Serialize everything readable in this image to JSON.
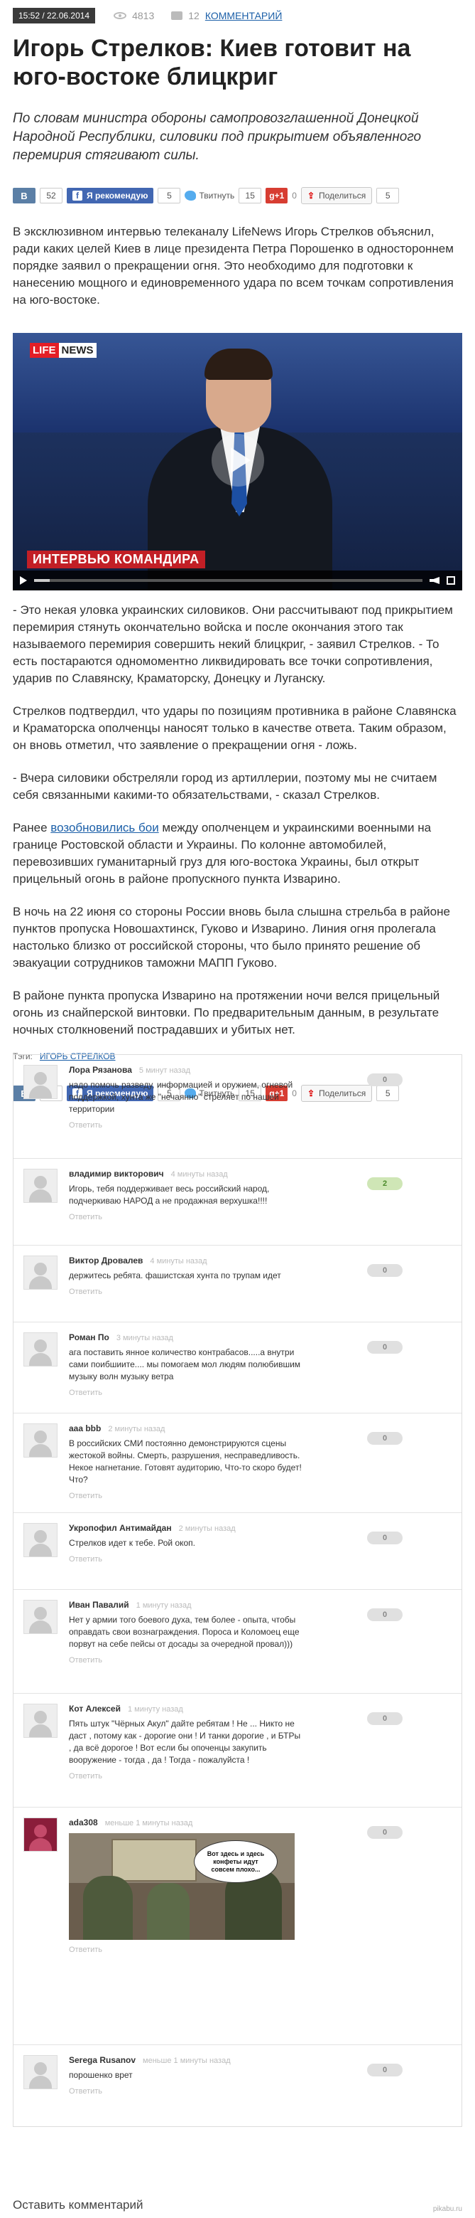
{
  "meta": {
    "date": "15:52 / 22.06.2014",
    "views": "4813",
    "comments_count": "12",
    "comments_link": "комментарий"
  },
  "article": {
    "title": "Игорь Стрелков: Киев готовит на юго-востоке блицкриг",
    "lead": "По словам министра обороны самопровозглашенной Донецкой Народной Республики, силовики под прикрытием объявленного перемирия стягивают силы.",
    "paragraphs": [
      "В эксклюзивном интервью телеканалу LifeNews Игорь Стрелков объяснил, ради каких целей Киев в лице президента Петра Порошенко в одностороннем порядке заявил о прекращении огня. Это необходимо для подготовки к нанесению мощного и единовременного удара по всем точкам сопротивления на юго-востоке.",
      "- Это некая уловка украинских силовиков. Они рассчитывают под прикрытием перемирия стянуть окончательно войска и после окончания этого так называемого перемирия совершить некий блицкриг, - заявил Стрелков. - То есть постараются одномоментно ликвидировать все точки сопротивления, ударив по Славянску, Краматорску, Донецку и Луганску.",
      "Стрелков подтвердил, что удары по позициям противника в районе Славянска и Краматорска ополченцы наносят только в качестве ответа. Таким образом, он вновь отметил, что заявление о прекращении огня - ложь.",
      "- Вчера силовики обстреляли город из артиллерии, поэтому мы не считаем себя связанными какими-то обязательствами, - сказал Стрелков."
    ],
    "p5_before": "Ранее ",
    "p5_link": "возобновились бои",
    "p5_after": " между ополченцем и украинскими военными на границе Ростовской области и Украины. По колонне автомобилей, перевозивших гуманитарный груз для юго-востока Украины, был открыт прицельный огонь в районе пропускного пункта Изварино.",
    "p6": "В ночь на 22 июня со стороны России вновь была слышна стрельба в районе пунктов пропуска Новошахтинск, Гуково и Изварино. Линия огня пролегала настолько близко от российской стороны, что было принято решение об эвакуации сотрудников таможни МАПП Гуково.",
    "p7": "В районе пункта пропуска Изварино на протяжении ночи велся прицельный огонь из снайперской винтовки. По предварительным данным, в результате ночных столкновений пострадавших и убитых нет."
  },
  "share": {
    "vk_label": "В",
    "vk_count": "52",
    "fb_label": "Я рекомендую",
    "fb_count": "5",
    "tw_label": "Твитнуть",
    "tw_count": "15",
    "gp_label": "g+1",
    "gp_count": "0",
    "share_label": "Поделиться",
    "share_count": "5"
  },
  "share_bottom": {
    "vk_label": "В",
    "vk_count": "52",
    "fb_label": "Я рекомендую",
    "fb_count": "5",
    "tw_label": "Твитнуть",
    "tw_count": "15",
    "gp_label": "g+1",
    "gp_count": "0",
    "share_label": "Поделиться",
    "share_count": "5"
  },
  "video": {
    "logo_a": "LIFE",
    "logo_b": "NEWS",
    "lower_third": "ИНТЕРВЬЮ КОМАНДИРА",
    "progress": 0.04
  },
  "tags": {
    "label": "Тэги:",
    "tag": "игорь стрелков"
  },
  "comments": [
    {
      "author": "Лора Рязанова",
      "time": "5 минут назад",
      "text": "надо помочь разведу, информацией и оружием, огневой поддержкой, хунта же \"нечаянно\" стреляет по нашей территории",
      "reply": "Ответить",
      "score": "0",
      "positive": false
    },
    {
      "author": "владимир викторович",
      "time": "4 минуты назад",
      "text": "Игорь, тебя поддерживает весь российский народ, подчеркиваю НАРОД а не продажная верхушка!!!!",
      "reply": "Ответить",
      "score": "2",
      "positive": true
    },
    {
      "author": "Виктор Дровалев",
      "time": "4 минуты назад",
      "text": "держитесь ребята. фашистская хунта по трупам идет",
      "reply": "Ответить",
      "score": "0",
      "positive": false
    },
    {
      "author": "Роман По",
      "time": "3 минуты назад",
      "text": "ага поставить янное количество контрабасов.....а внутри сами поибшиите.... мы помогаем мол людям полюбившим музыку волн музыку ветра",
      "reply": "Ответить",
      "score": "0",
      "positive": false
    },
    {
      "author": "aaa bbb",
      "time": "2 минуты назад",
      "text": "В российских СМИ постоянно демонстрируются сцены жестокой войны. Смерть, разрушения, несправедливость. Некое нагнетание. Готовят аудиторию, Что-то скоро будет! Что?",
      "reply": "Ответить",
      "score": "0",
      "positive": false
    },
    {
      "author": "Укропофил Антимайдан",
      "time": "2 минуты назад",
      "text": "Стрелков идет к тебе. Рой окоп.",
      "reply": "Ответить",
      "score": "0",
      "positive": false
    },
    {
      "author": "Иван Павалий",
      "time": "1 минуту назад",
      "text": "Нет у армии того боевого духа, тем более - опыта, чтобы оправдать свои вознаграждения. Пороса и Коломоец еще порвут на себе пейсы от досады за очередной провал)))",
      "reply": "Ответить",
      "score": "0",
      "positive": false
    },
    {
      "author": "Кот Алексей",
      "time": "1 минуту назад",
      "text": "Пять штук \"Чёрных Акул\" дайте ребятам ! Не ... Никто не даст , потому как - дорогие они ! И танки дорогие , и БТРы , да всё дорогое ! Вот если бы опоченцы закупить вооружение - тогда , да ! Тогда - пожалуйста !",
      "reply": "Ответить",
      "score": "0",
      "positive": false
    },
    {
      "author": "ada308",
      "time": "меньше 1 минуты назад",
      "image_caption": "Вот здесь и здесь конфеты идут совсем плохо...",
      "reply": "Ответить",
      "score": "0",
      "positive": false
    },
    {
      "author": "Serega Rusanov",
      "time": "меньше 1 минуты назад",
      "text": "порошенко врет",
      "reply": "Ответить",
      "score": "0",
      "positive": false
    }
  ],
  "leave_comment": "Оставить комментарий",
  "watermark": "pikabu.ru"
}
